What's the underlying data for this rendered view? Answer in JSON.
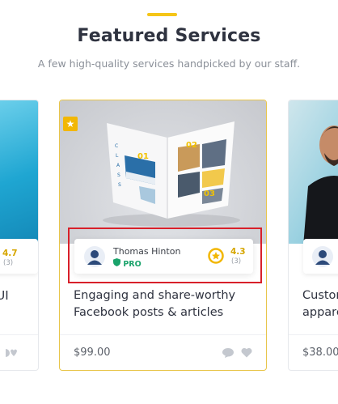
{
  "section": {
    "title": "Featured Services",
    "subtitle": "A few high-quality services handpicked by our staff.",
    "accent_color": "#f5c518"
  },
  "cards": [
    {
      "id": "left-partial",
      "title_fragment": "n UI",
      "rating": "4.7",
      "rating_count": "(3)"
    },
    {
      "id": "main",
      "featured": true,
      "author_name": "Thomas Hinton",
      "badge": "PRO",
      "rating": "4.3",
      "rating_count": "(3)",
      "title": "Engaging and share-worthy Facebook posts & articles",
      "price": "$99.00",
      "magazine_labels": [
        "01",
        "02",
        "03"
      ]
    },
    {
      "id": "right-partial",
      "title_fragment": "Custom apparel",
      "price": "$38.00"
    }
  ],
  "icons": {
    "featured": "star-icon",
    "pro": "shield-icon",
    "rating": "star-circle-icon",
    "message": "message-icon",
    "favorite": "heart-icon"
  },
  "colors": {
    "highlight_box": "#d8202a",
    "pro_green": "#1aa36b",
    "rating_gold": "#d6a600"
  }
}
